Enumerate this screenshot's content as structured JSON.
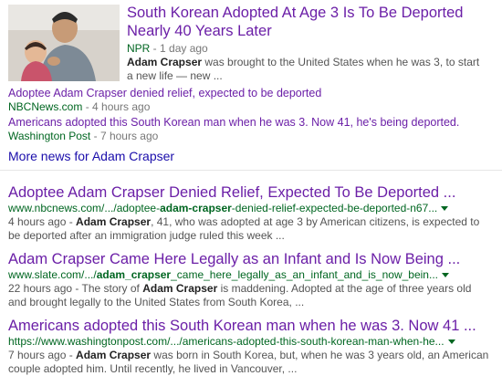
{
  "news": {
    "top_article": {
      "title_line1": "South Korean Adopted At Age 3 Is To Be Deported",
      "title_line2": "Nearly 40 Years Later",
      "source": "NPR",
      "time": " - 1 day ago",
      "snippet_bold": "Adam Crapser",
      "snippet_rest": " was brought to the United States when he was 3, to start a new life — new ..."
    },
    "articles": [
      {
        "title": "Adoptee Adam Crapser denied relief, expected to be deported",
        "source": "NBCNews.com",
        "time": " - 4 hours ago"
      },
      {
        "title": "Americans adopted this South Korean man when he was 3. Now 41, he's being deported.",
        "source": "Washington Post",
        "time": " - 7 hours ago"
      }
    ],
    "more_link": "More news for Adam Crapser"
  },
  "results": [
    {
      "title": "Adoptee Adam Crapser Denied Relief, Expected To Be Deported ...",
      "url_prefix": "www.nbcnews.com/.../adoptee-",
      "url_bold": "adam-crapser",
      "url_suffix": "-denied-relief-expected-be-deported-n67...",
      "time": "4 hours ago - ",
      "snippet_bold": "Adam Crapser",
      "snippet_rest": ", 41, who was adopted at age 3 by American citizens, is expected to be deported after an immigration judge ruled this week ..."
    },
    {
      "title": "Adam Crapser Came Here Legally as an Infant and Is Now Being ...",
      "url_prefix": "www.slate.com/.../",
      "url_bold": "adam_crapser",
      "url_suffix": "_came_here_legally_as_an_infant_and_is_now_bein...",
      "time": "22 hours ago - ",
      "snippet_pre": "The story of ",
      "snippet_bold": "Adam Crapser",
      "snippet_rest": " is maddening. Adopted at the age of three years old and brought legally to the United States from South Korea, ..."
    },
    {
      "title": "Americans adopted this South Korean man when he was 3. Now 41 ...",
      "url_prefix": "https://www.washingtonpost.com/.../americans-adopted-this-south-korean-man-when-he...",
      "url_bold": "",
      "url_suffix": "",
      "time": "7 hours ago - ",
      "snippet_bold": "Adam Crapser",
      "snippet_rest": " was born in South Korea, but, when he was 3 years old, an American couple adopted him. Until recently, he lived in Vancouver, ..."
    }
  ],
  "colors": {
    "visited_link": "#6b1fa7",
    "link": "#1a0dab",
    "url_green": "#006621",
    "snippet_gray": "#545454"
  }
}
